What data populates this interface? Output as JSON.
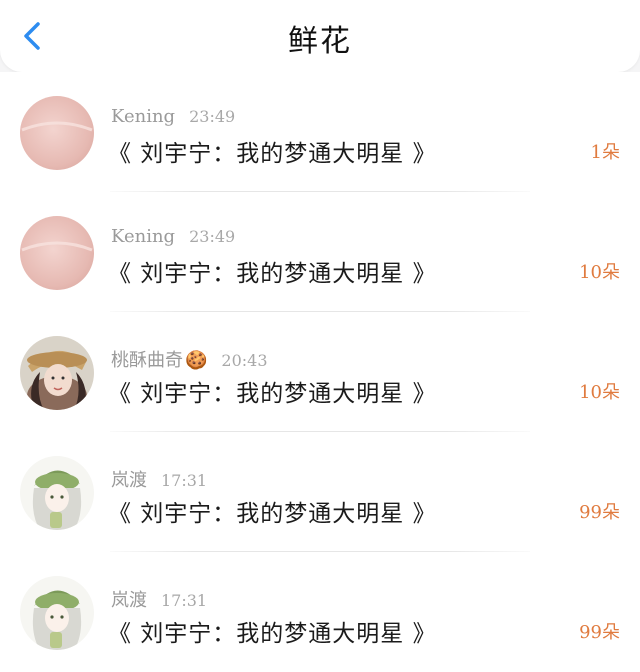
{
  "header": {
    "title": "鲜花",
    "back_icon": "chevron-left-icon",
    "accent_color": "#2d8cf0"
  },
  "items": [
    {
      "user": "Kening",
      "time": "23:49",
      "content": "《 刘宇宁：我的梦通大明星 》",
      "count": "1朵",
      "avatar": "pink-avatar"
    },
    {
      "user": "Kening",
      "time": "23:49",
      "content": "《 刘宇宁：我的梦通大明星 》",
      "count": "10朵",
      "avatar": "pink-avatar"
    },
    {
      "user": "桃酥曲奇",
      "emoji": "🍪",
      "time": "20:43",
      "content": "《 刘宇宁：我的梦通大明星 》",
      "count": "10朵",
      "avatar": "girl-hat-avatar"
    },
    {
      "user": "岚渡",
      "time": "17:31",
      "content": "《 刘宇宁：我的梦通大明星 》",
      "count": "99朵",
      "avatar": "anime-girl-avatar"
    },
    {
      "user": "岚渡",
      "time": "17:31",
      "content": "《 刘宇宁：我的梦通大明星 》",
      "count": "99朵",
      "avatar": "anime-girl-avatar"
    }
  ],
  "colors": {
    "count": "#e07b3f",
    "meta": "#9a9a9a"
  }
}
